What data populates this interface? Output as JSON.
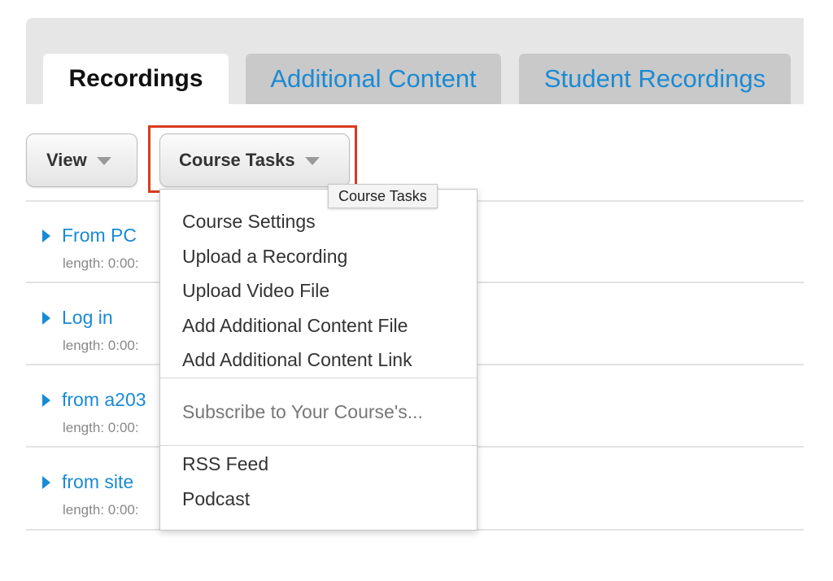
{
  "tabs": [
    {
      "label": "Recordings",
      "active": true
    },
    {
      "label": "Additional Content",
      "active": false
    },
    {
      "label": "Student Recordings",
      "active": false
    }
  ],
  "toolbar": {
    "view_label": "View",
    "course_tasks_label": "Course Tasks"
  },
  "tooltip": "Course Tasks",
  "recordings": [
    {
      "title": "From PC",
      "length": "length: 0:00:"
    },
    {
      "title": "Log in",
      "length": "length: 0:00:"
    },
    {
      "title": "from a203",
      "length": "length: 0:00:"
    },
    {
      "title": "from site",
      "length": "length: 0:00:"
    }
  ],
  "menu": {
    "items": [
      "Course Settings",
      "Upload a Recording",
      "Upload Video File",
      "Add Additional Content File",
      "Add Additional Content Link"
    ],
    "subscribe_header": "Subscribe to Your Course's...",
    "subscribe_items": [
      "RSS Feed",
      "Podcast"
    ]
  },
  "colors": {
    "link": "#1a8ad4",
    "highlight": "#d93a1f",
    "tab_strip": "#e6e6e6",
    "tab_inactive": "#c9c9c9"
  },
  "icons": {
    "dropdown_caret": "chevron-down-icon",
    "expand_toggle": "triangle-right-icon"
  }
}
